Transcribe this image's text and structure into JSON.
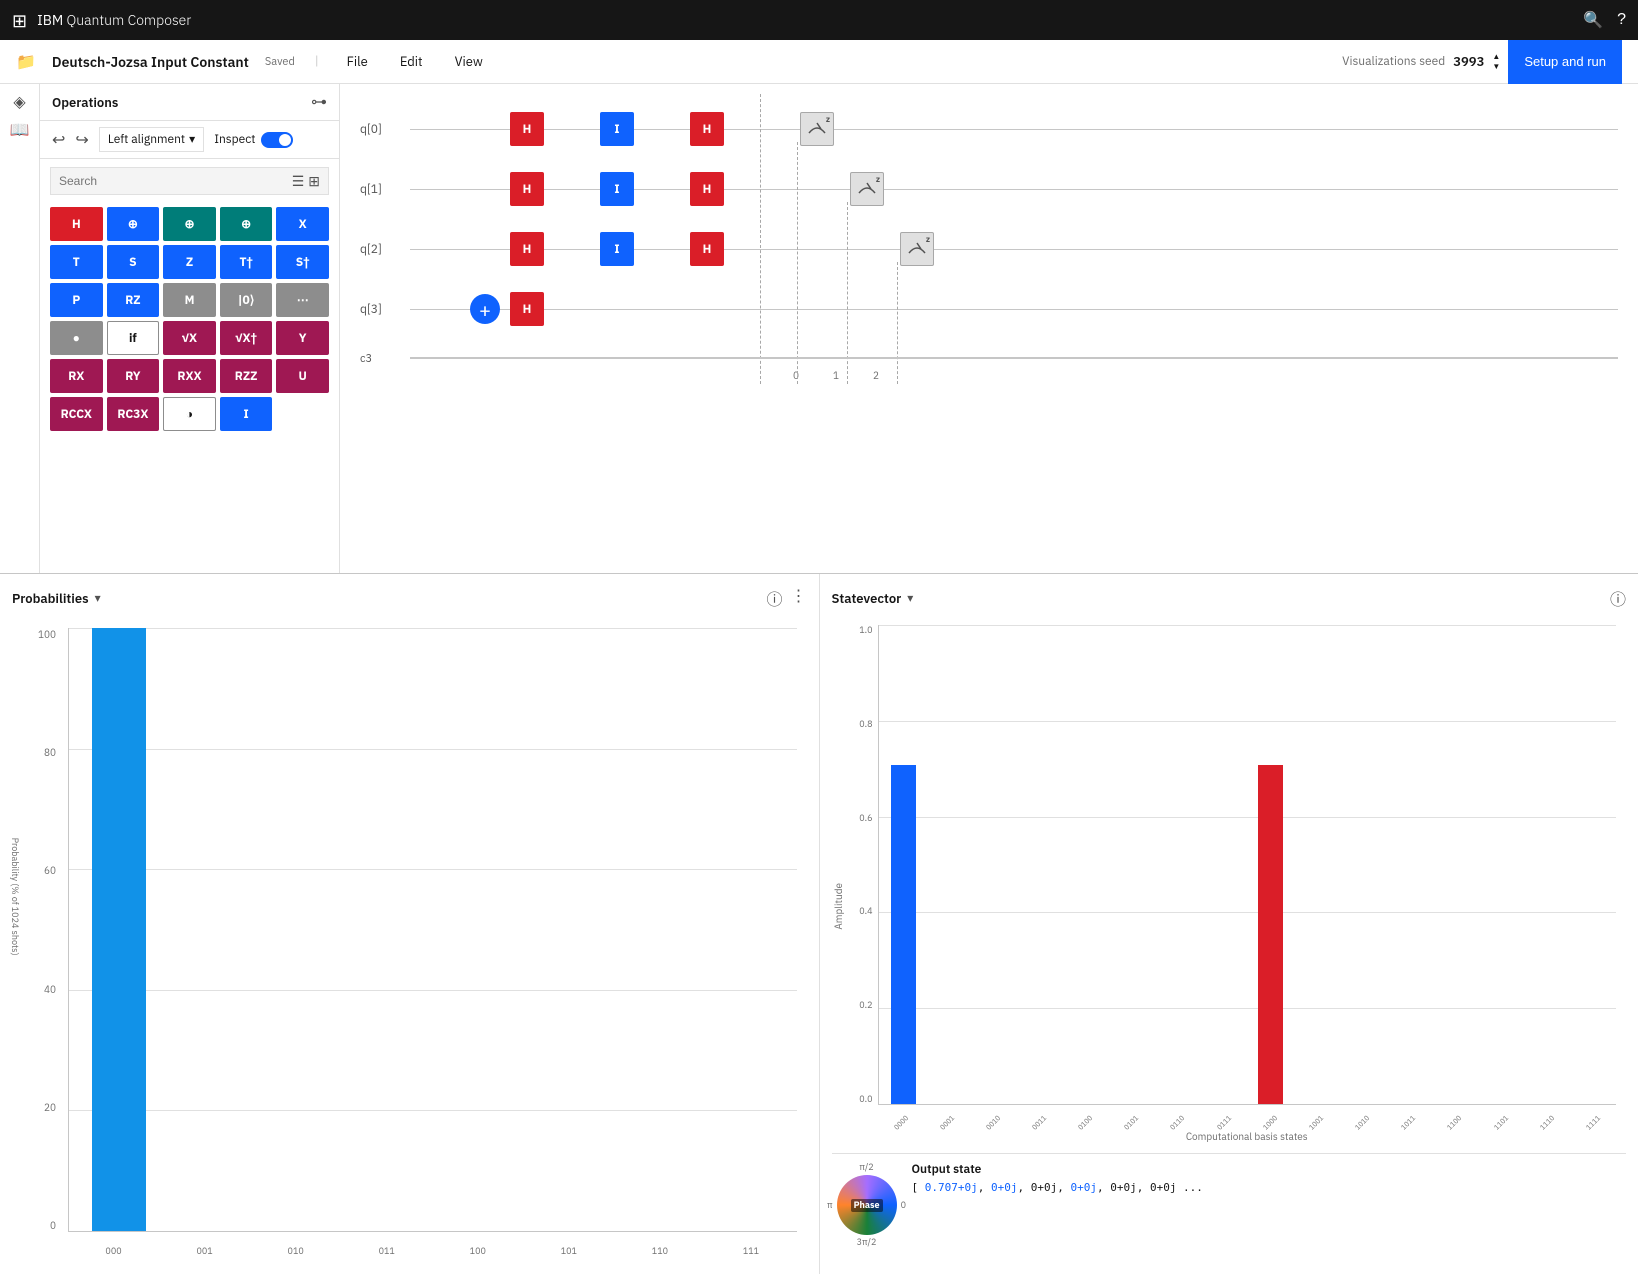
{
  "app": {
    "title": "IBM Quantum Composer",
    "title_bold": "IBM",
    "title_light": "Quantum Composer"
  },
  "header": {
    "doc_title": "Deutsch-Jozsa Input Constant",
    "saved": "Saved",
    "menu_items": [
      "File",
      "Edit",
      "View"
    ],
    "vis_seed_label": "Visualizations seed",
    "vis_seed_value": "3993",
    "run_btn": "Setup and run"
  },
  "toolbar": {
    "ops_title": "Operations",
    "align_label": "Left alignment",
    "inspect_label": "Inspect"
  },
  "search": {
    "placeholder": "Search"
  },
  "gates": [
    {
      "label": "H",
      "color": "red"
    },
    {
      "label": "⊕",
      "color": "blue"
    },
    {
      "label": "⊕",
      "color": "teal"
    },
    {
      "label": "⊕",
      "color": "teal"
    },
    {
      "label": "X",
      "color": "blue"
    },
    {
      "label": "T",
      "color": "blue"
    },
    {
      "label": "S",
      "color": "blue"
    },
    {
      "label": "Z",
      "color": "blue"
    },
    {
      "label": "T†",
      "color": "blue"
    },
    {
      "label": "S†",
      "color": "blue"
    },
    {
      "label": "P",
      "color": "blue"
    },
    {
      "label": "RZ",
      "color": "blue"
    },
    {
      "label": "M",
      "color": "gray"
    },
    {
      "label": "|0⟩",
      "color": "gray"
    },
    {
      "label": "⋯",
      "color": "gray"
    },
    {
      "label": "●",
      "color": "gray"
    },
    {
      "label": "if",
      "color": "outline"
    },
    {
      "label": "√X",
      "color": "magenta"
    },
    {
      "label": "√X†",
      "color": "magenta"
    },
    {
      "label": "Y",
      "color": "magenta"
    },
    {
      "label": "RX",
      "color": "magenta"
    },
    {
      "label": "RY",
      "color": "magenta"
    },
    {
      "label": "RXX",
      "color": "magenta"
    },
    {
      "label": "RZZ",
      "color": "magenta"
    },
    {
      "label": "U",
      "color": "magenta"
    },
    {
      "label": "RCCX",
      "color": "magenta"
    },
    {
      "label": "RC3X",
      "color": "magenta"
    },
    {
      "label": "◑",
      "color": "outline"
    },
    {
      "label": "I",
      "color": "blue"
    }
  ],
  "circuit": {
    "qubits": [
      "q[0]",
      "q[1]",
      "q[2]",
      "q[3]"
    ],
    "classical": "c3"
  },
  "probabilities": {
    "title": "Probabilities",
    "y_label": "Probability (% of 1024 shots)",
    "y_axis": [
      "100",
      "80",
      "60",
      "40",
      "20",
      "0"
    ],
    "bars": [
      {
        "label": "000",
        "value": 100
      },
      {
        "label": "001",
        "value": 0
      },
      {
        "label": "010",
        "value": 0
      },
      {
        "label": "011",
        "value": 0
      },
      {
        "label": "100",
        "value": 0
      },
      {
        "label": "101",
        "value": 0
      },
      {
        "label": "110",
        "value": 0
      },
      {
        "label": "111",
        "value": 0
      }
    ]
  },
  "statevector": {
    "title": "Statevector",
    "y_label": "Amplitude",
    "x_label": "Computational basis states",
    "y_axis": [
      "1.0",
      "0.8",
      "0.6",
      "0.4",
      "0.2",
      "0.0"
    ],
    "bars": [
      {
        "label": "0000",
        "value": 0.707,
        "color": "#0f62fe"
      },
      {
        "label": "0001",
        "value": 0,
        "color": "#0f62fe"
      },
      {
        "label": "0010",
        "value": 0,
        "color": "#0f62fe"
      },
      {
        "label": "0011",
        "value": 0,
        "color": "#0f62fe"
      },
      {
        "label": "0100",
        "value": 0,
        "color": "#0f62fe"
      },
      {
        "label": "0101",
        "value": 0,
        "color": "#0f62fe"
      },
      {
        "label": "0110",
        "value": 0,
        "color": "#0f62fe"
      },
      {
        "label": "0111",
        "value": 0,
        "color": "#0f62fe"
      },
      {
        "label": "1000",
        "value": 0.707,
        "color": "#da1e28"
      },
      {
        "label": "1001",
        "value": 0,
        "color": "#0f62fe"
      },
      {
        "label": "1010",
        "value": 0,
        "color": "#0f62fe"
      },
      {
        "label": "1011",
        "value": 0,
        "color": "#0f62fe"
      },
      {
        "label": "1100",
        "value": 0,
        "color": "#0f62fe"
      },
      {
        "label": "1101",
        "value": 0,
        "color": "#0f62fe"
      },
      {
        "label": "1110",
        "value": 0,
        "color": "#0f62fe"
      },
      {
        "label": "1111",
        "value": 0,
        "color": "#0f62fe"
      }
    ],
    "output_state_title": "Output state",
    "output_state_value": "[ 0.707+0j, 0+0j, 0+0j, 0+0j, 0+0j, 0+0j ...",
    "phase_label": "Phase",
    "phase_ticks": [
      "π/2",
      "π",
      "0",
      "3π/2"
    ]
  }
}
